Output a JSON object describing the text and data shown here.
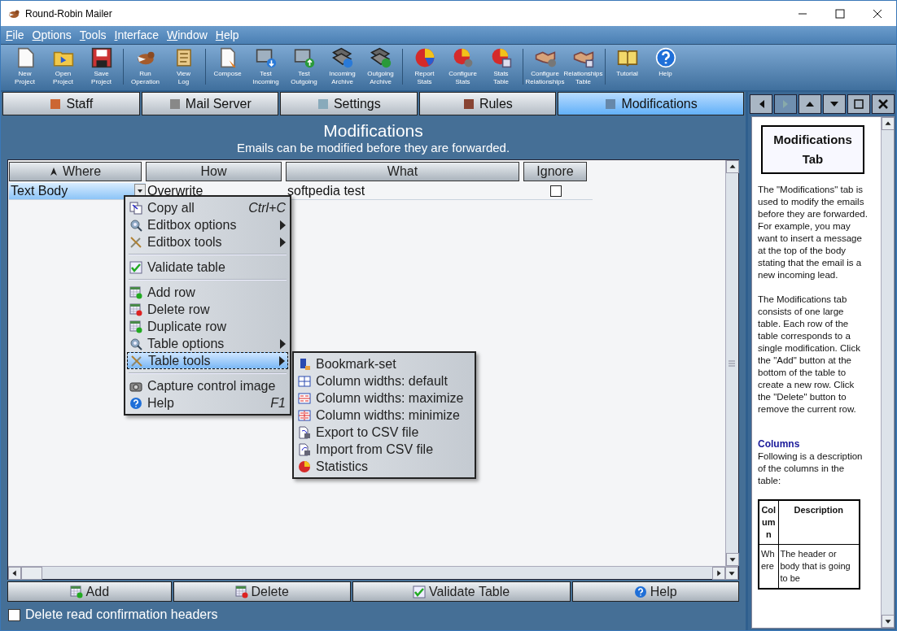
{
  "window": {
    "title": "Round-Robin Mailer"
  },
  "menu_bar": [
    "File",
    "Options",
    "Tools",
    "Interface",
    "Window",
    "Help"
  ],
  "toolbar": [
    {
      "label": "New\nProject"
    },
    {
      "label": "Open\nProject"
    },
    {
      "label": "Save\nProject"
    },
    {
      "label": "Run\nOperation"
    },
    {
      "label": "View\nLog"
    },
    {
      "label": "Compose"
    },
    {
      "label": "Test\nIncoming"
    },
    {
      "label": "Test\nOutgoing"
    },
    {
      "label": "Incoming\nArchive"
    },
    {
      "label": "Outgoing\nArchive"
    },
    {
      "label": "Report\nStats"
    },
    {
      "label": "Configure\nStats"
    },
    {
      "label": "Stats\nTable"
    },
    {
      "label": "Configure\nRelationships"
    },
    {
      "label": "Relationships\nTable"
    },
    {
      "label": "Tutorial"
    },
    {
      "label": "Help"
    }
  ],
  "tabs": [
    {
      "label": "Staff",
      "selected": false
    },
    {
      "label": "Mail Server",
      "selected": false
    },
    {
      "label": "Settings",
      "selected": false
    },
    {
      "label": "Rules",
      "selected": false
    },
    {
      "label": "Modifications",
      "selected": true
    }
  ],
  "page": {
    "title": "Modifications",
    "subtitle": "Emails can be modified before they are forwarded."
  },
  "table": {
    "columns": [
      {
        "label": "Where",
        "sorted": true
      },
      {
        "label": "How",
        "sorted": false
      },
      {
        "label": "What",
        "sorted": false
      },
      {
        "label": "Ignore",
        "sorted": false
      }
    ],
    "rows": [
      {
        "where": "Text Body",
        "how": "Overwrite",
        "what": "softpedia test",
        "ignore": false,
        "selected": true
      }
    ]
  },
  "context_menu": {
    "groups": [
      [
        {
          "label": "Copy all",
          "shortcut": "Ctrl+C",
          "submenu": false,
          "selected": false
        },
        {
          "label": "Editbox options",
          "submenu": true,
          "selected": false
        },
        {
          "label": "Editbox tools",
          "submenu": true,
          "selected": false
        }
      ],
      [
        {
          "label": "Validate table",
          "submenu": false,
          "selected": false
        }
      ],
      [
        {
          "label": "Add row",
          "submenu": false,
          "selected": false
        },
        {
          "label": "Delete row",
          "submenu": false,
          "selected": false
        },
        {
          "label": "Duplicate row",
          "submenu": false,
          "selected": false
        },
        {
          "label": "Table options",
          "submenu": true,
          "selected": false
        },
        {
          "label": "Table tools",
          "submenu": true,
          "selected": true
        }
      ],
      [
        {
          "label": "Capture control image",
          "submenu": false,
          "selected": false
        },
        {
          "label": "Help",
          "shortcut": "F1",
          "submenu": false,
          "selected": false
        }
      ]
    ],
    "submenu": [
      "Bookmark-set",
      "Column widths: default",
      "Column widths: maximize",
      "Column widths: minimize",
      "Export to CSV file",
      "Import from CSV file",
      "Statistics"
    ]
  },
  "bottom_buttons": [
    "Add",
    "Delete",
    "Validate Table",
    "Help"
  ],
  "option": {
    "label": "Delete read confirmation headers",
    "checked": false
  },
  "help_panel": {
    "title": "Modifications Tab",
    "paragraphs": [
      "The \"Modifications\" tab is used to modify the emails before they are forwarded.  For example, you may want to insert a message at the top of the body stating that the email is a new incoming lead.",
      "The Modifications tab consists of one large table.  Each row of the table corresponds to a single modification. Click the \"Add\" button at the bottom of the table to create a new row.  Click the \"Delete\" button to remove the current row."
    ],
    "section_title": "Columns",
    "section_text": "Following is a description of the columns in the table:",
    "table": {
      "columns": [
        "Column",
        "Description"
      ],
      "rows": [
        [
          "Where",
          "The header or body that is going to be"
        ]
      ]
    }
  }
}
